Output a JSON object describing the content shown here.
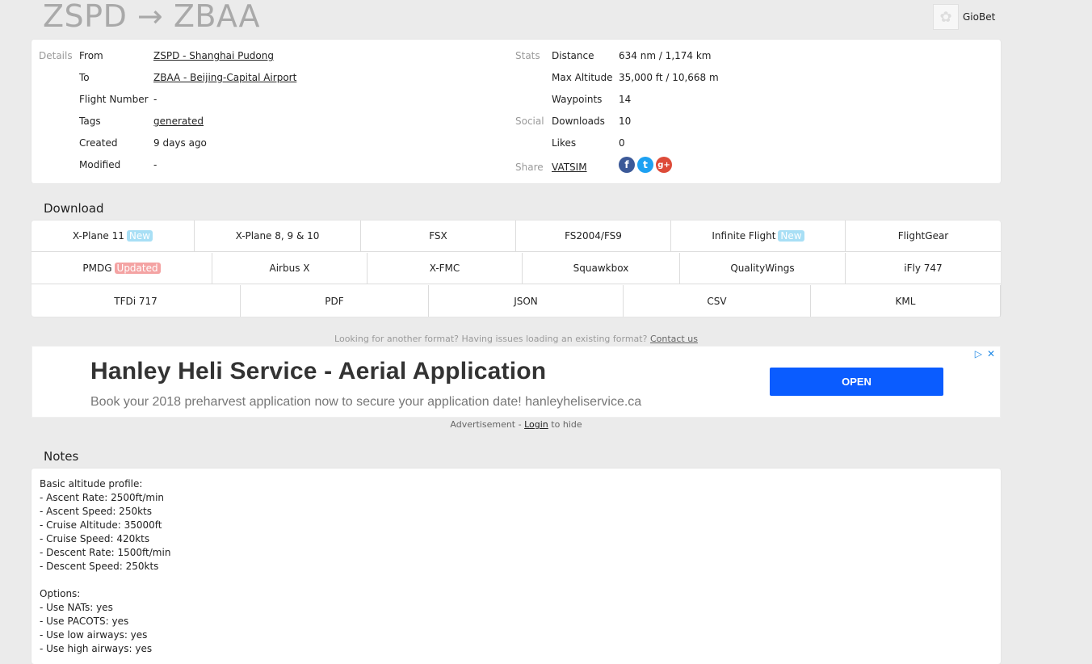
{
  "header": {
    "title": "ZSPD → ZBAA",
    "username": "GioBet"
  },
  "details": {
    "section_label": "Details",
    "from_label": "From",
    "from_value": "ZSPD - Shanghai Pudong",
    "to_label": "To",
    "to_value": "ZBAA - Beijing-Capital Airport",
    "flight_number_label": "Flight Number",
    "flight_number_value": "-",
    "tags_label": "Tags",
    "tags_value": "generated",
    "created_label": "Created",
    "created_value": "9 days ago",
    "modified_label": "Modified",
    "modified_value": "-"
  },
  "stats": {
    "section_label": "Stats",
    "distance_label": "Distance",
    "distance_value": "634 nm / 1,174 km",
    "max_altitude_label": "Max Altitude",
    "max_altitude_value": "35,000 ft / 10,668 m",
    "waypoints_label": "Waypoints",
    "waypoints_value": "14"
  },
  "social": {
    "section_label": "Social",
    "downloads_label": "Downloads",
    "downloads_value": "10",
    "likes_label": "Likes",
    "likes_value": "0",
    "share_label": "Share",
    "share_link": "VATSIM",
    "share_icons": [
      "facebook-icon",
      "twitter-icon",
      "google-plus-icon"
    ]
  },
  "download": {
    "title": "Download",
    "row1": [
      {
        "label": "X-Plane 11",
        "badge": "New"
      },
      {
        "label": "X-Plane 8, 9 & 10"
      },
      {
        "label": "FSX"
      },
      {
        "label": "FS2004/FS9"
      },
      {
        "label": "Infinite Flight",
        "badge": "New"
      },
      {
        "label": "FlightGear"
      }
    ],
    "row2": [
      {
        "label": "PMDG",
        "badge": "Updated"
      },
      {
        "label": "Airbus X"
      },
      {
        "label": "X-FMC"
      },
      {
        "label": "Squawkbox"
      },
      {
        "label": "QualityWings"
      },
      {
        "label": "iFly 747"
      }
    ],
    "row3": [
      {
        "label": "TFDi 717"
      },
      {
        "label": "PDF"
      },
      {
        "label": "JSON"
      },
      {
        "label": "CSV"
      },
      {
        "label": "KML"
      }
    ],
    "help_text": "Looking for another format? Having issues loading an existing format?",
    "contact_link": "Contact us"
  },
  "ad": {
    "title": "Hanley Heli Service - Aerial Application",
    "subtitle": "Book your 2018 preharvest application now to secure your application date! hanleyheliservice.ca",
    "button": "OPEN",
    "note_prefix": "Advertisement -",
    "note_link": "Login",
    "note_suffix": "to hide"
  },
  "notes": {
    "title": "Notes",
    "text": "Basic altitude profile:\n- Ascent Rate: 2500ft/min\n- Ascent Speed: 250kts\n- Cruise Altitude: 35000ft\n- Cruise Speed: 420kts\n- Descent Rate: 1500ft/min\n- Descent Speed: 250kts\n\nOptions:\n- Use NATs: yes\n- Use PACOTS: yes\n- Use low airways: yes\n- Use high airways: yes"
  },
  "colors": {
    "badge_new": "#a8dff5",
    "badge_updated": "#f4a3a3",
    "ad_button": "#0a5cff",
    "facebook": "#3b5998",
    "twitter": "#1da1f2",
    "google_plus": "#dd4b39"
  }
}
